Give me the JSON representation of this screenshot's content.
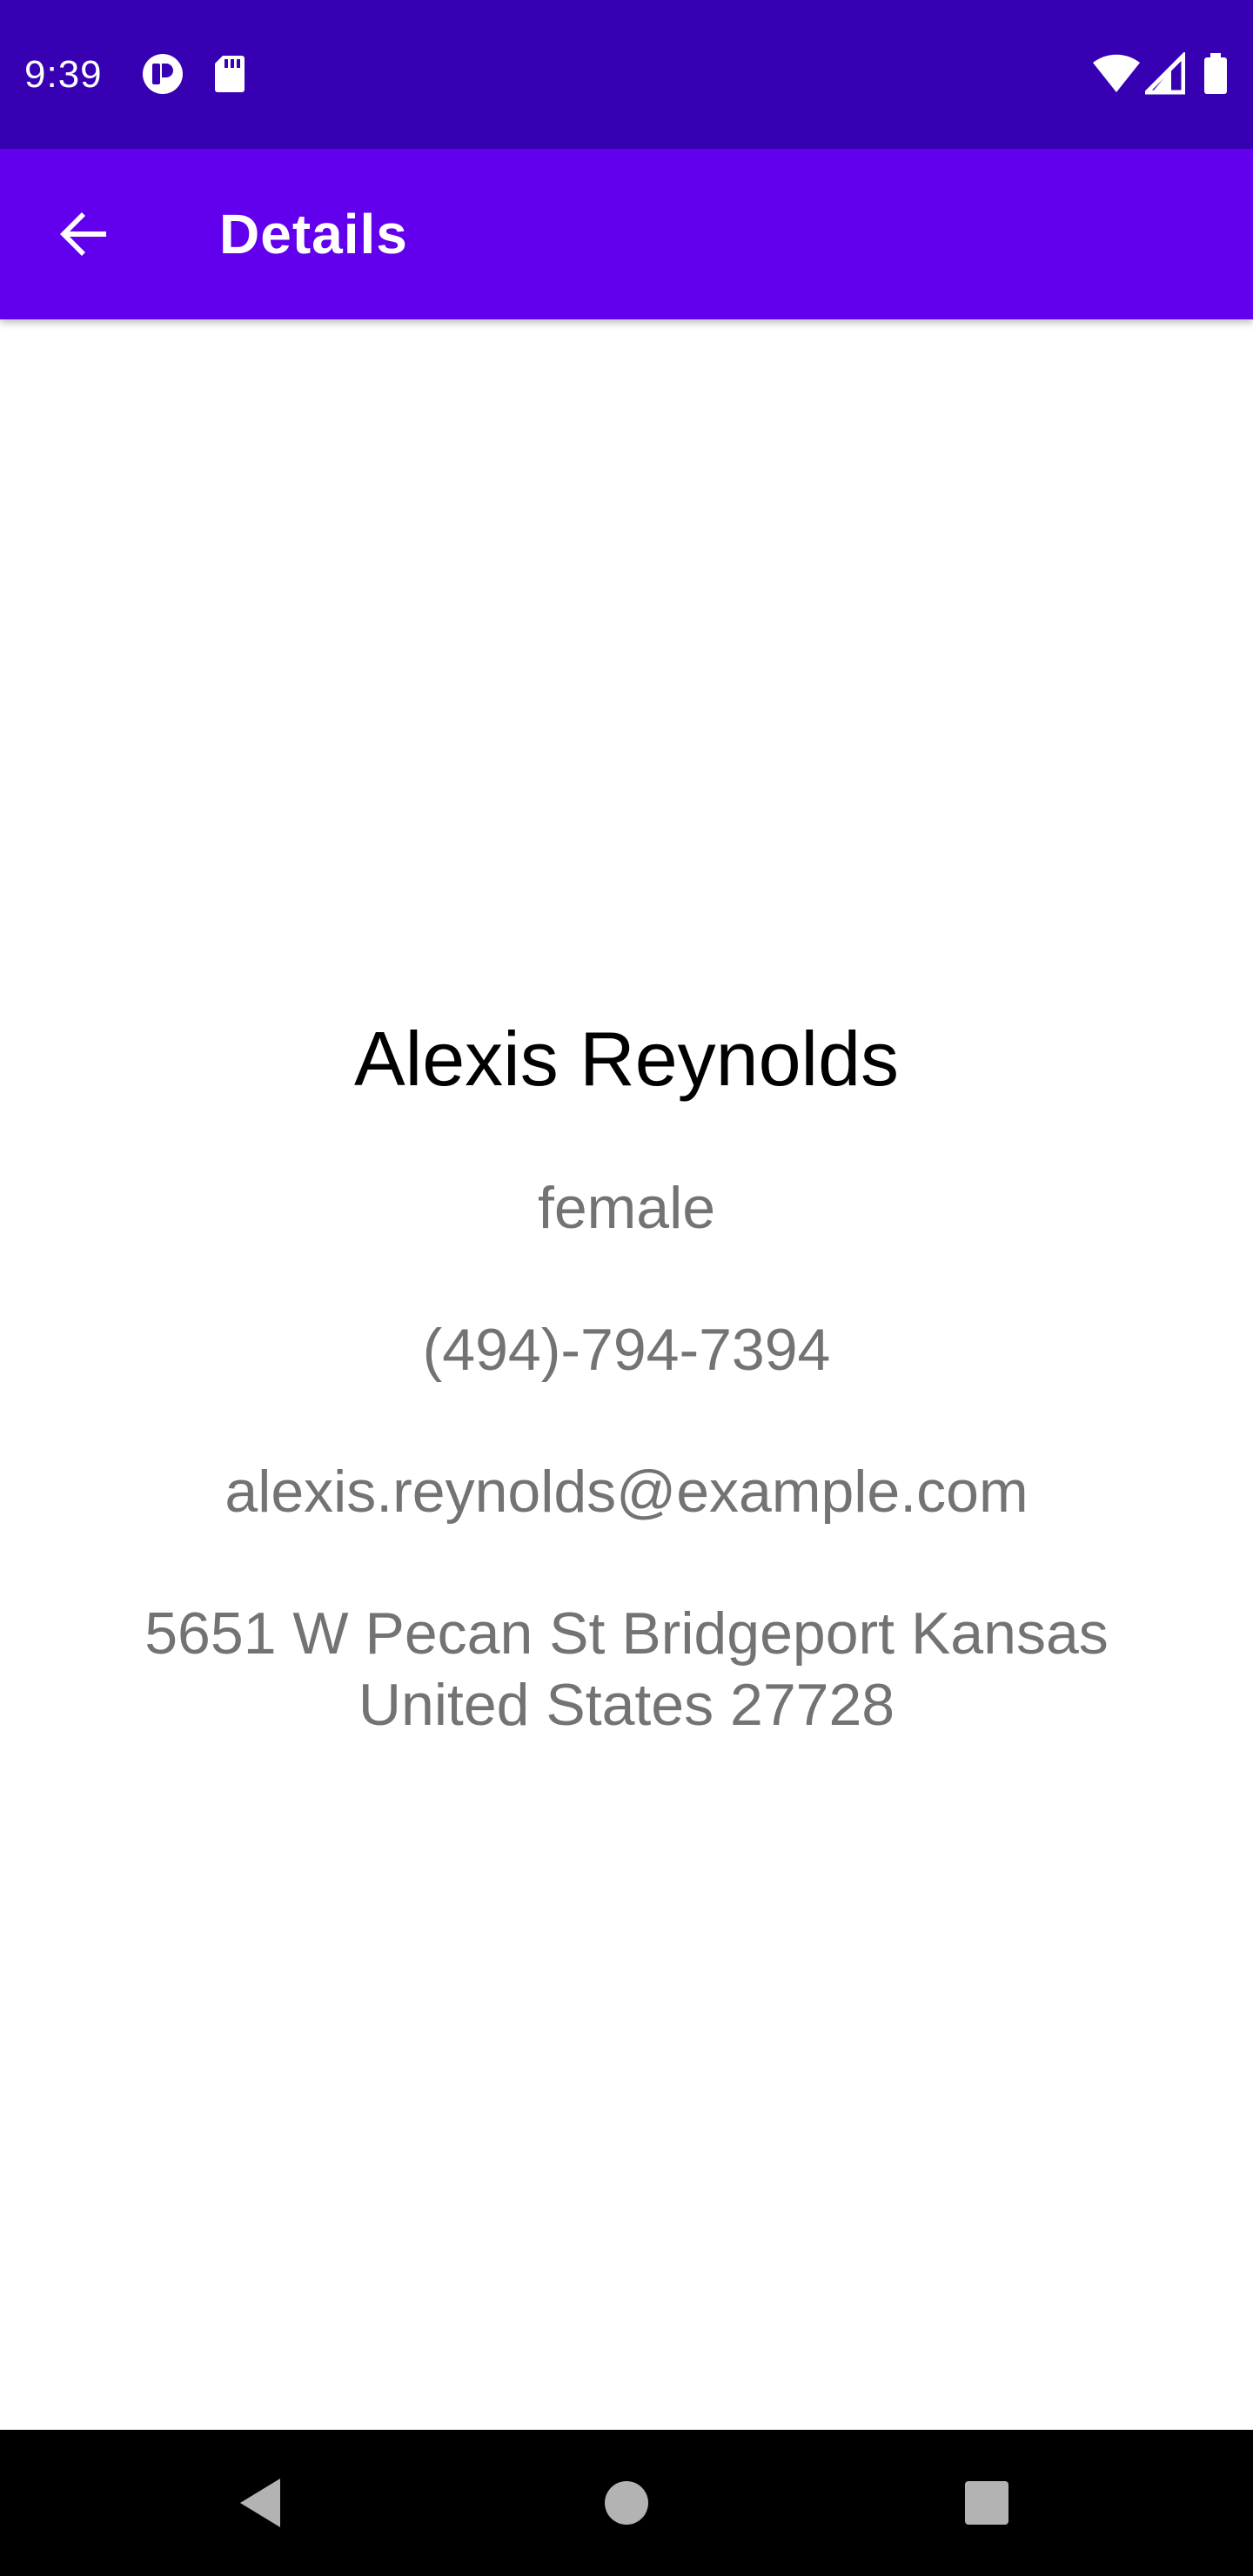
{
  "status_bar": {
    "time": "9:39",
    "left_icons": [
      "app-notification-icon",
      "sd-card-icon"
    ],
    "right_icons": [
      "wifi-icon",
      "cell-signal-icon",
      "battery-icon"
    ],
    "background_color": "#3700b3"
  },
  "app_bar": {
    "title": "Details",
    "back_icon": "arrow-back-icon",
    "background_color": "#6200ee"
  },
  "contact": {
    "name": "Alexis Reynolds",
    "gender": "female",
    "phone": "(494)-794-7394",
    "email": "alexis.reynolds@example.com",
    "address_line1": "5651 W Pecan St Bridgeport Kansas",
    "address_line2": "United States 27728"
  },
  "nav_bar": {
    "buttons": [
      "back-triangle-icon",
      "home-circle-icon",
      "recents-square-icon"
    ]
  }
}
